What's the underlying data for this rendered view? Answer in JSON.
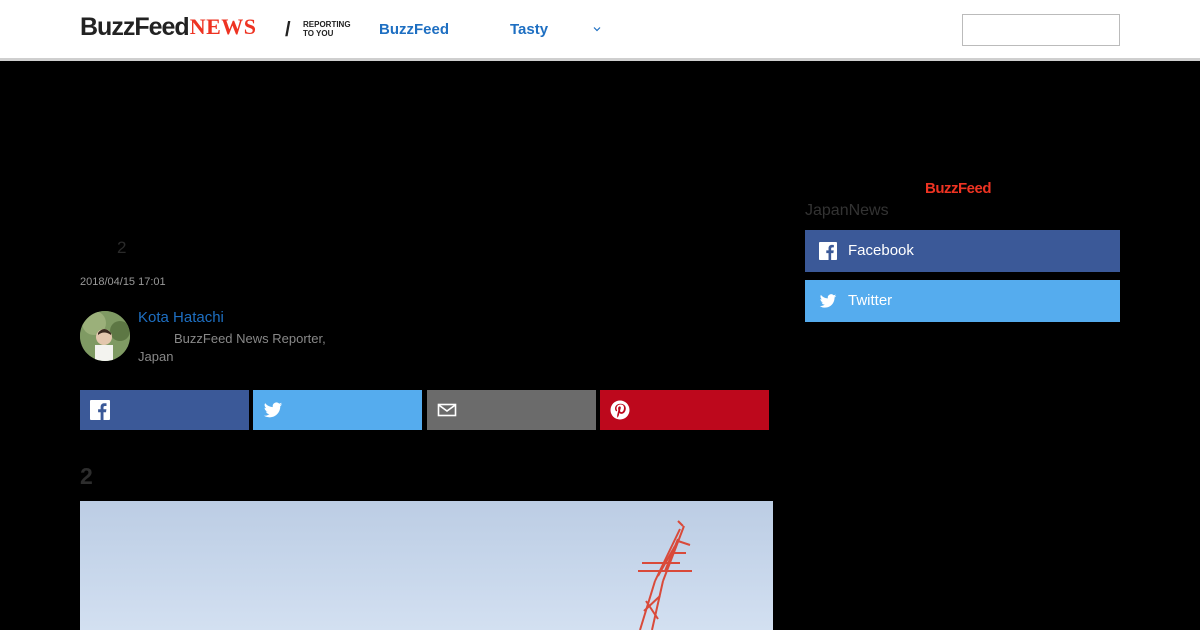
{
  "header": {
    "logo_buzzfeed": "BuzzFeed",
    "logo_news": "NEWS",
    "logo_slash": "/",
    "logo_tagline": "REPORTING TO YOU",
    "nav": [
      {
        "label": "BuzzFeed"
      },
      {
        "label": "Tasty"
      }
    ],
    "more_icon": "chevron-down-icon",
    "search_placeholder": ""
  },
  "article": {
    "headline_fragment": "2",
    "date": "2018/04/15 17:01",
    "author": {
      "name": "Kota Hatachi",
      "role": "BuzzFeed News Reporter, Japan"
    },
    "share_buttons": [
      {
        "network": "facebook",
        "icon": "facebook-icon",
        "color": "#3b5998"
      },
      {
        "network": "twitter",
        "icon": "twitter-icon",
        "color": "#55acee"
      },
      {
        "network": "email",
        "icon": "mail-icon",
        "color": "#6b6b6b"
      },
      {
        "network": "pinterest",
        "icon": "pinterest-icon",
        "color": "#bd081c"
      }
    ],
    "section_heading": "2"
  },
  "sidebar": {
    "logo": "BuzzFeed",
    "title": "JapanNews",
    "follow": [
      {
        "label": "Facebook",
        "icon": "facebook-icon",
        "color": "#3b5998"
      },
      {
        "label": "Twitter",
        "icon": "twitter-icon",
        "color": "#55acee"
      }
    ]
  }
}
